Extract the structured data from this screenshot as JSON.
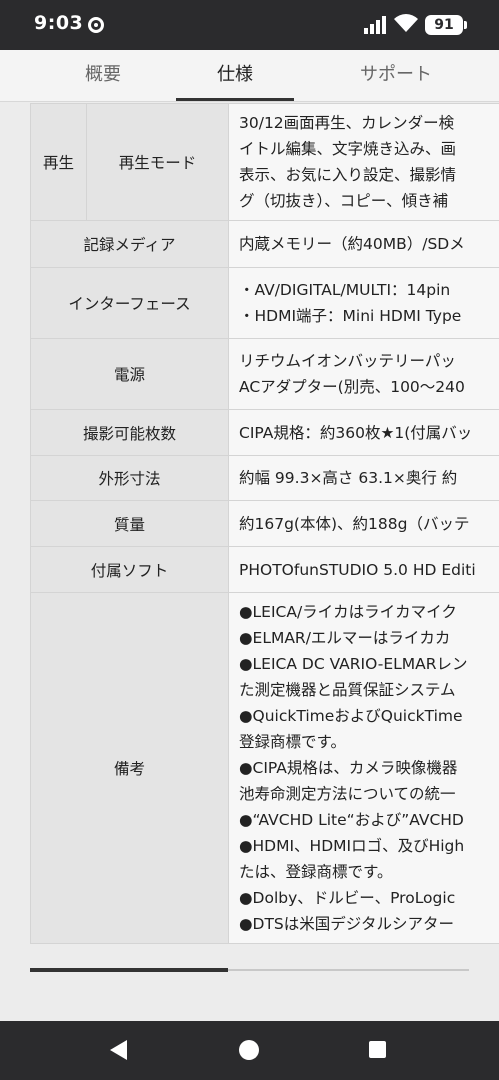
{
  "status": {
    "time": "9:03",
    "battery": "91"
  },
  "tabs": [
    {
      "label": "概要"
    },
    {
      "label": "仕様"
    },
    {
      "label": "サポート"
    }
  ],
  "spec": {
    "playback": {
      "header": "再生",
      "sub_header": "再生モード",
      "lines": [
        "30/12画面再生、カレンダー検",
        "イトル編集、文字焼き込み、画",
        "表示、お気に入り設定、撮影情",
        "グ（切抜き）、コピー、傾き補"
      ]
    },
    "media": {
      "label": "記録メディア",
      "value": "内蔵メモリー（約40MB）/SDメ"
    },
    "interface": {
      "label": "インターフェース",
      "lines": [
        "・AV/DIGITAL/MULTI：14pin",
        "・HDMI端子：Mini HDMI Type"
      ]
    },
    "power": {
      "label": "電源",
      "lines": [
        "リチウムイオンバッテリーパッ",
        "ACアダプター(別売、100〜240"
      ]
    },
    "shots": {
      "label": "撮影可能枚数",
      "value": "CIPA規格：約360枚★1(付属バッ"
    },
    "dimensions": {
      "label": "外形寸法",
      "value": "約幅 99.3×高さ 63.1×奥行 約"
    },
    "weight": {
      "label": "質量",
      "value": "約167g(本体)、約188g（バッテ"
    },
    "software": {
      "label": "付属ソフト",
      "value": "PHOTOfunSTUDIO 5.0 HD Editi"
    },
    "notes": {
      "label": "備考",
      "lines": [
        "●LEICA/ライカはライカマイク",
        "●ELMAR/エルマーはライカカ",
        "●LEICA DC VARIO-ELMARレン",
        "た測定機器と品質保証システム",
        "●QuickTimeおよびQuickTime",
        "登録商標です。",
        "●CIPA規格は、カメラ映像機器",
        "池寿命測定方法についての統一",
        "●“AVCHD Lite“および”AVCHD",
        "●HDMI、HDMIロゴ、及びHigh",
        "たは、登録商標です。",
        "●Dolby、ドルビー、ProLogic",
        "●DTSは米国デジタルシアター"
      ]
    }
  },
  "scroll": {
    "position": 0.45
  },
  "colors": {
    "status_bar": "#2b2b2d",
    "header_cell": "#e4e4e4",
    "value_cell": "#f7f7f7"
  }
}
